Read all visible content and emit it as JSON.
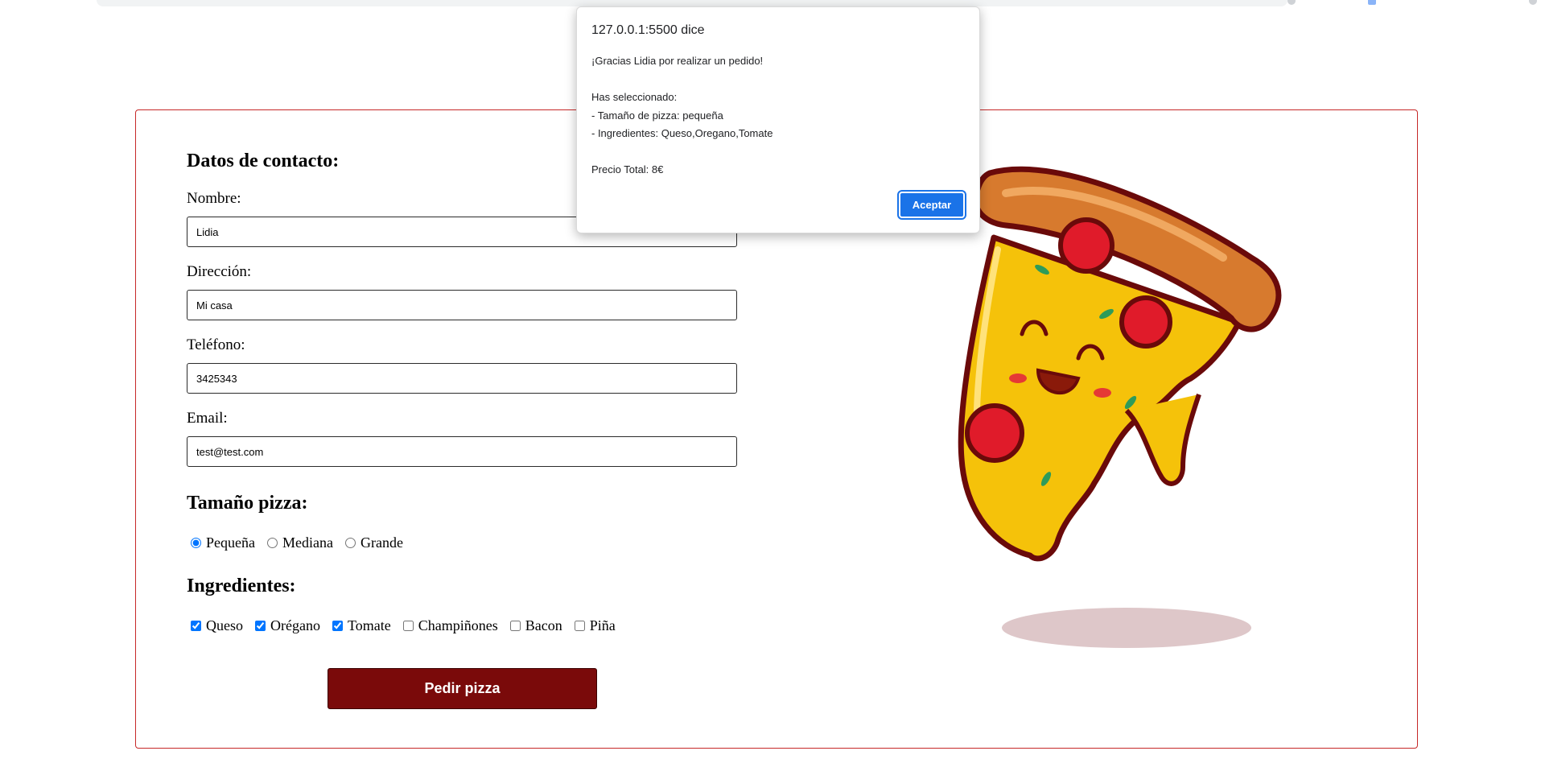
{
  "form": {
    "contact_title": "Datos de contacto:",
    "name_label": "Nombre:",
    "name_value": "Lidia",
    "address_label": "Dirección:",
    "address_value": "Mi casa",
    "phone_label": "Teléfono:",
    "phone_value": "3425343",
    "email_label": "Email:",
    "email_value": "test@test.com",
    "size_title": "Tamaño pizza:",
    "sizes": [
      {
        "label": "Pequeña",
        "checked": true
      },
      {
        "label": "Mediana",
        "checked": false
      },
      {
        "label": "Grande",
        "checked": false
      }
    ],
    "ingredients_title": "Ingredientes:",
    "ingredients": [
      {
        "label": "Queso",
        "checked": true
      },
      {
        "label": "Orégano",
        "checked": true
      },
      {
        "label": "Tomate",
        "checked": true
      },
      {
        "label": "Champiñones",
        "checked": false
      },
      {
        "label": "Bacon",
        "checked": false
      },
      {
        "label": "Piña",
        "checked": false
      }
    ],
    "submit_label": "Pedir pizza"
  },
  "dialog": {
    "title": "127.0.0.1:5500 dice",
    "lines": [
      "¡Gracias Lidia por realizar un pedido!",
      "",
      "Has seleccionado:",
      "- Tamaño de pizza: pequeña",
      "- Ingredientes: Queso,Oregano,Tomate",
      "",
      "Precio Total: 8€"
    ],
    "ok_label": "Aceptar"
  },
  "colors": {
    "card_border": "#c62828",
    "submit_bg": "#7a0a0a",
    "dialog_button": "#1a73e8"
  }
}
